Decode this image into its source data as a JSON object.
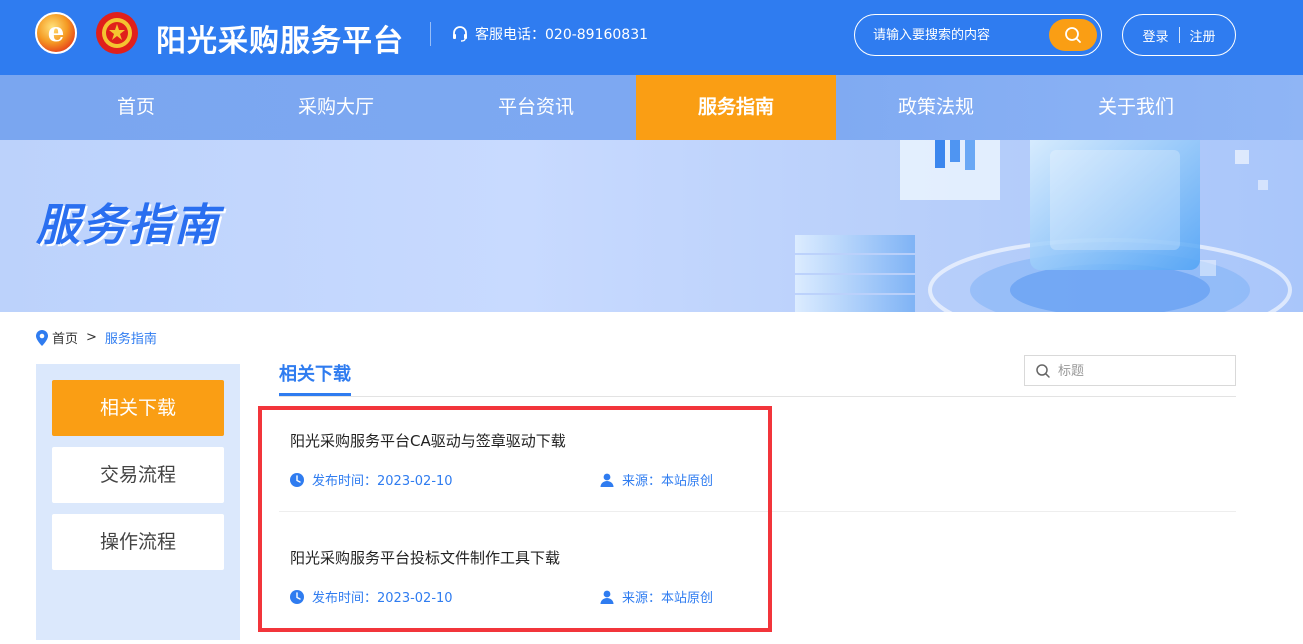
{
  "header": {
    "logo_letter": "e",
    "site_title": "阳光采购服务平台",
    "hotline": "客服电话：020-89160831",
    "search_placeholder": "请输入要搜索的内容",
    "login_label": "登录",
    "register_label": "注册"
  },
  "nav": {
    "items": [
      {
        "label": "首页"
      },
      {
        "label": "采购大厅"
      },
      {
        "label": "平台资讯"
      },
      {
        "label": "服务指南"
      },
      {
        "label": "政策法规"
      },
      {
        "label": "关于我们"
      }
    ],
    "active_index": 3
  },
  "banner": {
    "title": "服务指南"
  },
  "breadcrumb": {
    "home": "首页",
    "separator": ">",
    "current": "服务指南"
  },
  "sidebar": {
    "items": [
      {
        "label": "相关下载"
      },
      {
        "label": "交易流程"
      },
      {
        "label": "操作流程"
      }
    ],
    "active_index": 0
  },
  "content": {
    "tab_title": "相关下载",
    "search_placeholder": "标题",
    "items": [
      {
        "title": "阳光采购服务平台CA驱动与签章驱动下载",
        "date": "发布时间：2023-02-10",
        "source": "来源：本站原创"
      },
      {
        "title": "阳光采购服务平台投标文件制作工具下载",
        "date": "发布时间：2023-02-10",
        "source": "来源：本站原创"
      }
    ]
  },
  "colors": {
    "primary": "#2f7cf0",
    "accent": "#fa9e14",
    "highlight_border": "#f2353b",
    "sidebar_bg": "#dbe8fc"
  }
}
